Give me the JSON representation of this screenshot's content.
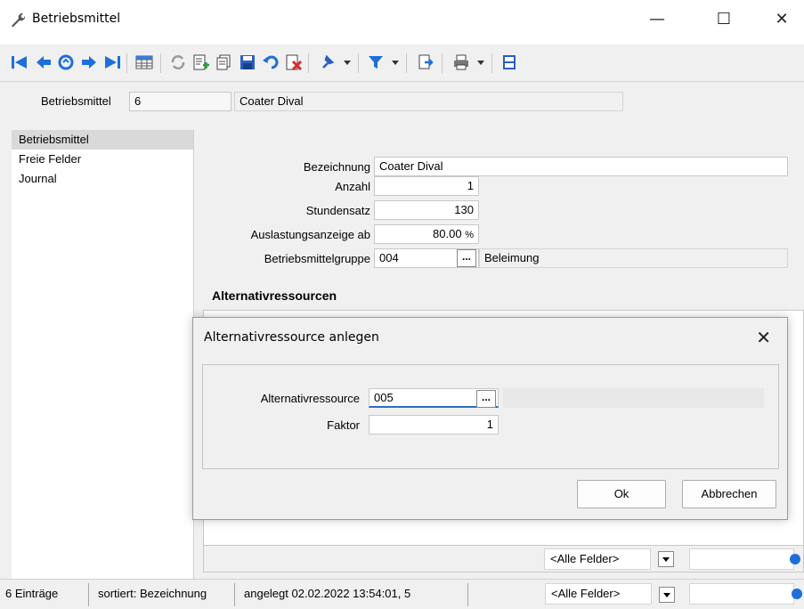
{
  "window": {
    "title": "Betriebsmittel",
    "controls": {
      "minimize": "—",
      "maximize": "☐",
      "close": "✕"
    }
  },
  "toolbar": {
    "icons": [
      "first-record-icon",
      "previous-record-icon",
      "search-icon",
      "next-record-icon",
      "last-record-icon",
      "table-view-icon",
      "refresh-icon",
      "new-record-icon",
      "copy-record-icon",
      "save-icon",
      "undo-icon",
      "delete-icon",
      "pin-icon",
      "filter-icon",
      "export-icon",
      "print-icon",
      "properties-icon"
    ]
  },
  "header": {
    "label": "Betriebsmittel",
    "id_value": "6",
    "name_value": "Coater Dival"
  },
  "nav": {
    "items": [
      "Betriebsmittel",
      "Freie Felder",
      "Journal"
    ],
    "selected": 0
  },
  "form": {
    "bezeichnung_label": "Bezeichnung",
    "bezeichnung_value": "Coater Dival",
    "anzahl_label": "Anzahl",
    "anzahl_value": "1",
    "stundensatz_label": "Stundensatz",
    "stundensatz_value": "130",
    "auslastung_label": "Auslastungsanzeige ab",
    "auslastung_value": "80.00",
    "auslastung_unit": "%",
    "gruppe_label": "Betriebsmittelgruppe",
    "gruppe_value": "004",
    "gruppe_browse": "...",
    "gruppe_name": "Beleimung"
  },
  "alternatives": {
    "title": "Alternativressourcen",
    "filter_combo": "<Alle Felder>"
  },
  "dialog": {
    "title": "Alternativressource anlegen",
    "close": "✕",
    "ressource_label": "Alternativressource",
    "ressource_value": "005",
    "ressource_browse": "...",
    "faktor_label": "Faktor",
    "faktor_value": "1",
    "ok_label": "Ok",
    "cancel_label": "Abbrechen"
  },
  "statusbar": {
    "count": "6 Einträge",
    "sort": "sortiert: Bezeichnung",
    "created": "angelegt 02.02.2022 13:54:01,  5",
    "filter_combo": "<Alle Felder>"
  },
  "colors": {
    "accent_blue": "#1e6fd9",
    "focus_underline": "#2b6bc4"
  }
}
